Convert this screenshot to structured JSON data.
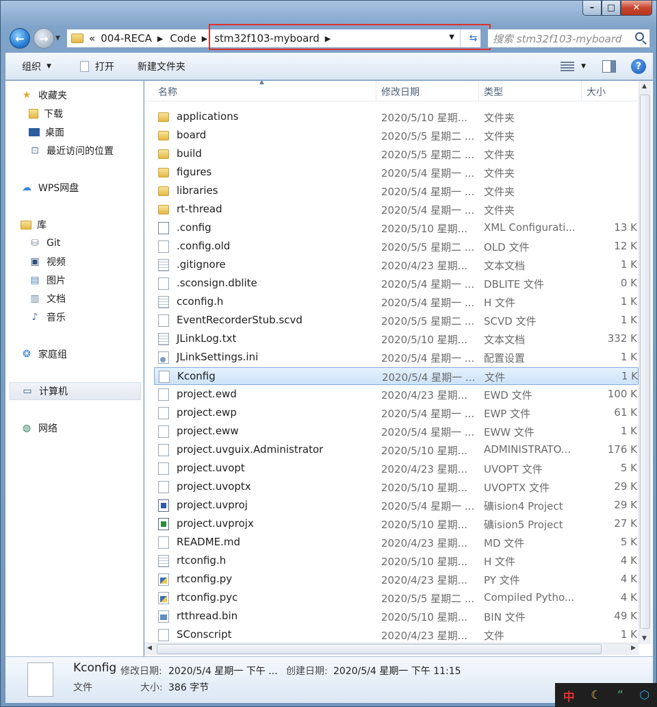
{
  "address": {
    "crumbs": [
      "«",
      "004-RECA",
      "Code",
      "stm32f103-myboard"
    ],
    "search_placeholder": "搜索 stm32f103-myboard"
  },
  "toolbar": {
    "organize": "组织",
    "open": "打开",
    "new_folder": "新建文件夹"
  },
  "sidebar": {
    "items": [
      {
        "label": "收藏夹",
        "icon": "star-icon"
      },
      {
        "label": "下载",
        "icon": "download-folder-icon"
      },
      {
        "label": "桌面",
        "icon": "desktop-icon"
      },
      {
        "label": "最近访问的位置",
        "icon": "recent-places-icon"
      },
      {
        "label": "WPS网盘",
        "icon": "cloud-icon"
      },
      {
        "label": "库",
        "icon": "library-icon"
      },
      {
        "label": "Git",
        "icon": "git-library-icon"
      },
      {
        "label": "视频",
        "icon": "video-icon"
      },
      {
        "label": "图片",
        "icon": "picture-icon"
      },
      {
        "label": "文档",
        "icon": "document-library-icon"
      },
      {
        "label": "音乐",
        "icon": "music-icon"
      },
      {
        "label": "家庭组",
        "icon": "homegroup-icon"
      },
      {
        "label": "计算机",
        "icon": "computer-icon"
      },
      {
        "label": "网络",
        "icon": "network-icon"
      }
    ]
  },
  "columns": {
    "name": "名称",
    "date": "修改日期",
    "type": "类型",
    "size": "大小"
  },
  "files": [
    {
      "name": "applications",
      "date": "2020/5/10 星期...",
      "type": "文件夹",
      "size": "",
      "icon": "folder"
    },
    {
      "name": "board",
      "date": "2020/5/5 星期二 ...",
      "type": "文件夹",
      "size": "",
      "icon": "folder"
    },
    {
      "name": "build",
      "date": "2020/5/5 星期二 ...",
      "type": "文件夹",
      "size": "",
      "icon": "folder"
    },
    {
      "name": "figures",
      "date": "2020/5/4 星期一 ...",
      "type": "文件夹",
      "size": "",
      "icon": "folder"
    },
    {
      "name": "libraries",
      "date": "2020/5/4 星期一 ...",
      "type": "文件夹",
      "size": "",
      "icon": "folder"
    },
    {
      "name": "rt-thread",
      "date": "2020/5/4 星期一 ...",
      "type": "文件夹",
      "size": "",
      "icon": "folder"
    },
    {
      "name": ".config",
      "date": "2020/5/10 星期...",
      "type": "XML Configurati...",
      "size": "13 K",
      "icon": "config"
    },
    {
      "name": ".config.old",
      "date": "2020/5/5 星期二 ...",
      "type": "OLD 文件",
      "size": "12 K",
      "icon": "file"
    },
    {
      "name": ".gitignore",
      "date": "2020/4/23 星期...",
      "type": "文本文档",
      "size": "1 K",
      "icon": "txt"
    },
    {
      "name": ".sconsign.dblite",
      "date": "2020/5/4 星期一 ...",
      "type": "DBLITE 文件",
      "size": "0 K",
      "icon": "file"
    },
    {
      "name": "cconfig.h",
      "date": "2020/5/4 星期一 ...",
      "type": "H 文件",
      "size": "1 K",
      "icon": "txt"
    },
    {
      "name": "EventRecorderStub.scvd",
      "date": "2020/5/5 星期二 ...",
      "type": "SCVD 文件",
      "size": "1 K",
      "icon": "file"
    },
    {
      "name": "JLinkLog.txt",
      "date": "2020/5/10 星期...",
      "type": "文本文档",
      "size": "332 K",
      "icon": "txt"
    },
    {
      "name": "JLinkSettings.ini",
      "date": "2020/5/4 星期一 ...",
      "type": "配置设置",
      "size": "1 K",
      "icon": "gear"
    },
    {
      "name": "Kconfig",
      "date": "2020/5/4 星期一 ...",
      "type": "文件",
      "size": "1 K",
      "icon": "file"
    },
    {
      "name": "project.ewd",
      "date": "2020/4/23 星期...",
      "type": "EWD 文件",
      "size": "100 K",
      "icon": "file"
    },
    {
      "name": "project.ewp",
      "date": "2020/5/4 星期一 ...",
      "type": "EWP 文件",
      "size": "61 K",
      "icon": "file"
    },
    {
      "name": "project.eww",
      "date": "2020/5/4 星期一 ...",
      "type": "EWW 文件",
      "size": "1 K",
      "icon": "file"
    },
    {
      "name": "project.uvguix.Administrator",
      "date": "2020/5/10 星期...",
      "type": "ADMINISTRATO...",
      "size": "176 K",
      "icon": "file"
    },
    {
      "name": "project.uvopt",
      "date": "2020/4/23 星期...",
      "type": "UVOPT 文件",
      "size": "5 K",
      "icon": "file"
    },
    {
      "name": "project.uvoptx",
      "date": "2020/5/10 星期...",
      "type": "UVOPTX 文件",
      "size": "29 K",
      "icon": "file"
    },
    {
      "name": "project.uvproj",
      "date": "2020/5/4 星期一 ...",
      "type": "礦ision4 Project",
      "size": "29 K",
      "icon": "proj"
    },
    {
      "name": "project.uvprojx",
      "date": "2020/5/10 星期...",
      "type": "礦ision5 Project",
      "size": "27 K",
      "icon": "projx"
    },
    {
      "name": "README.md",
      "date": "2020/4/23 星期...",
      "type": "MD 文件",
      "size": "5 K",
      "icon": "file"
    },
    {
      "name": "rtconfig.h",
      "date": "2020/5/10 星期...",
      "type": "H 文件",
      "size": "4 K",
      "icon": "txt"
    },
    {
      "name": "rtconfig.py",
      "date": "2020/4/23 星期...",
      "type": "PY 文件",
      "size": "4 K",
      "icon": "py"
    },
    {
      "name": "rtconfig.pyc",
      "date": "2020/5/5 星期二 ...",
      "type": "Compiled Pytho...",
      "size": "4 K",
      "icon": "py"
    },
    {
      "name": "rtthread.bin",
      "date": "2020/5/10 星期...",
      "type": "BIN 文件",
      "size": "49 K",
      "icon": "bin"
    },
    {
      "name": "SConscript",
      "date": "2020/4/23 星期...",
      "type": "文件",
      "size": "1 K",
      "icon": "file"
    }
  ],
  "selected_file": "Kconfig",
  "details": {
    "name": "Kconfig",
    "type": "文件",
    "modified_label": "修改日期:",
    "modified_value": "2020/5/4 星期一 下午 ...",
    "created_label": "创建日期:",
    "created_value": "2020/5/4 星期一 下午 11:15",
    "size_label": "大小:",
    "size_value": "386 字节"
  },
  "ime": {
    "lang": "中"
  },
  "colors": {
    "highlight_border": "#e0302d",
    "selection": "#cde3f8"
  }
}
